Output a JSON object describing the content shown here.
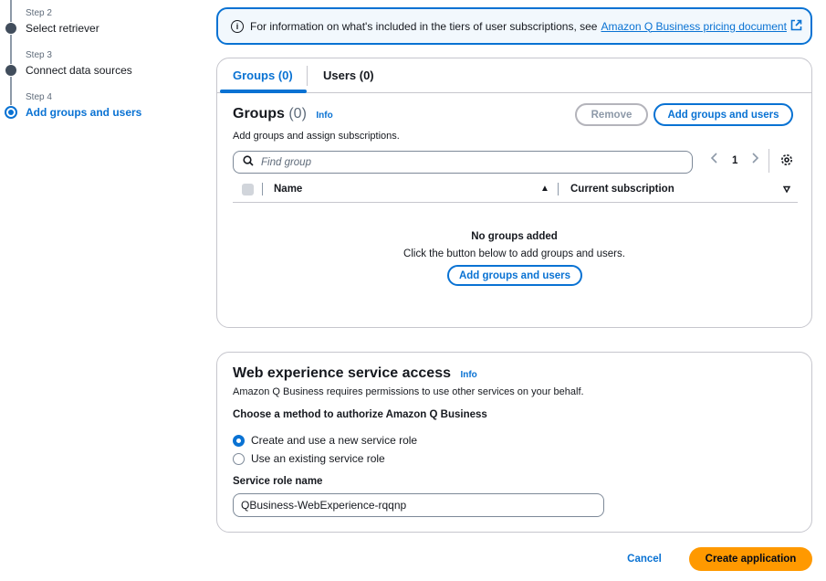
{
  "stepper": {
    "steps": [
      {
        "label": "Step 2",
        "title": "Select retriever"
      },
      {
        "label": "Step 3",
        "title": "Connect data sources"
      },
      {
        "label": "Step 4",
        "title": "Add groups and users"
      }
    ]
  },
  "banner": {
    "text": "For information on what's included in the tiers of user subscriptions, see",
    "link": "Amazon Q Business pricing document"
  },
  "groups_card": {
    "tabs": [
      {
        "label": "Groups (0)"
      },
      {
        "label": "Users (0)"
      }
    ],
    "title": "Groups",
    "count": "(0)",
    "info": "Info",
    "description": "Add groups and assign subscriptions.",
    "remove_label": "Remove",
    "add_label": "Add groups and users",
    "search_placeholder": "Find group",
    "page": "1",
    "columns": [
      "Name",
      "Current subscription"
    ],
    "empty_title": "No groups added",
    "empty_desc": "Click the button below to add groups and users.",
    "empty_button": "Add groups and users"
  },
  "web_card": {
    "title": "Web experience service access",
    "info": "Info",
    "description": "Amazon Q Business requires permissions to use other services on your behalf.",
    "method_label": "Choose a method to authorize Amazon Q Business",
    "options": [
      {
        "label": "Create and use a new service role",
        "selected": true
      },
      {
        "label": "Use an existing service role",
        "selected": false
      }
    ],
    "role_label": "Service role name",
    "role_value": "QBusiness-WebExperience-rqqnp"
  },
  "footer": {
    "cancel": "Cancel",
    "create": "Create application"
  },
  "colors": {
    "accent": "#0972d3",
    "primary_button": "#ff9900"
  }
}
